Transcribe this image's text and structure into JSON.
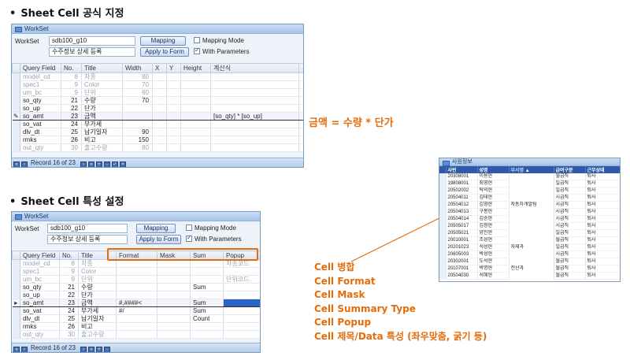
{
  "headings": {
    "formula": "Sheet Cell 공식 지정",
    "attributes": "Sheet Cell 특성 설정"
  },
  "panel1": {
    "title": "WorkSet",
    "workset_label": "WorkSet",
    "workset_value": "sdb100_g10",
    "name_value": "수주정보 상세 등록",
    "mapping_button": "Mapping",
    "apply_button": "Apply to Form",
    "mapping_mode_label": "Mapping Mode",
    "mapping_mode_checked": false,
    "with_params_label": "With Parameters",
    "with_params_checked": true,
    "columns": [
      "Query Field",
      "No.",
      "Title",
      "Width",
      "X",
      "Y",
      "Height",
      "계산식"
    ],
    "rows": [
      {
        "field": "model_cd",
        "no": "8",
        "title": "차종",
        "width": "80",
        "formula": "",
        "gray": true
      },
      {
        "field": "spec1",
        "no": "9",
        "title": "Color",
        "width": "70",
        "formula": "",
        "gray": true
      },
      {
        "field": "um_bc",
        "no": "9",
        "title": "단위",
        "width": "60",
        "formula": "",
        "gray": true
      },
      {
        "field": "so_qty",
        "no": "21",
        "title": "수량",
        "width": "70",
        "formula": "",
        "gray": false
      },
      {
        "field": "so_up",
        "no": "22",
        "title": "단가",
        "width": "",
        "formula": "",
        "gray": false
      },
      {
        "field": "so_amt",
        "no": "23",
        "title": "금액",
        "width": "",
        "formula": "[so_qty] * [so_up]",
        "gray": false,
        "selected": true
      },
      {
        "field": "so_vat",
        "no": "24",
        "title": "부가세",
        "width": "",
        "formula": "",
        "gray": false
      },
      {
        "field": "dlv_dt",
        "no": "25",
        "title": "납기일자",
        "width": "90",
        "formula": "",
        "gray": false
      },
      {
        "field": "rmks",
        "no": "26",
        "title": "비고",
        "width": "150",
        "formula": "",
        "gray": false
      },
      {
        "field": "out_qty",
        "no": "30",
        "title": "출고수량",
        "width": "80",
        "formula": "",
        "gray": true
      }
    ],
    "record_text": "Record 16 of 23"
  },
  "panel2": {
    "title": "WorkSet",
    "workset_label": "WorkSet",
    "workset_value": "sdb100_g10",
    "name_value": "수주정보 상세 등록",
    "mapping_button": "Mapping",
    "apply_button": "Apply to Form",
    "mapping_mode_label": "Mapping Mode",
    "with_params_label": "With Parameters",
    "columns": [
      "Query Field",
      "No.",
      "Title",
      "Format",
      "Mask",
      "Sum",
      "Popup"
    ],
    "rows": [
      {
        "field": "model_cd",
        "no": "8",
        "title": "차종",
        "format": "",
        "mask": "",
        "sum": "",
        "popup": "차종코드",
        "gray": true
      },
      {
        "field": "spec1",
        "no": "9",
        "title": "Color",
        "format": "",
        "mask": "",
        "sum": "",
        "popup": "",
        "gray": true
      },
      {
        "field": "um_bc",
        "no": "9",
        "title": "단위",
        "format": "",
        "mask": "",
        "sum": "",
        "popup": "단위코드",
        "gray": true
      },
      {
        "field": "so_qty",
        "no": "21",
        "title": "수량",
        "format": "",
        "mask": "",
        "sum": "Sum",
        "popup": "",
        "gray": false
      },
      {
        "field": "so_up",
        "no": "22",
        "title": "단가",
        "format": "",
        "mask": "",
        "sum": "",
        "popup": "",
        "gray": false
      },
      {
        "field": "so_amt",
        "no": "23",
        "title": "금액",
        "format": "#,####<",
        "mask": "",
        "sum": "Sum",
        "popup": "",
        "gray": false,
        "selected": true
      },
      {
        "field": "so_vat",
        "no": "24",
        "title": "부가세",
        "format": "#/",
        "mask": "",
        "sum": "Sum",
        "popup": "",
        "gray": false
      },
      {
        "field": "dlv_dt",
        "no": "25",
        "title": "납기일자",
        "format": "",
        "mask": "",
        "sum": "Count",
        "popup": "",
        "gray": false
      },
      {
        "field": "rmks",
        "no": "26",
        "title": "비고",
        "format": "",
        "mask": "",
        "sum": "",
        "popup": "",
        "gray": false
      },
      {
        "field": "out_qty",
        "no": "30",
        "title": "출고수량",
        "format": "",
        "mask": "",
        "sum": "",
        "popup": "",
        "gray": true
      }
    ],
    "record_text": "Record 16 of 23"
  },
  "annotations": {
    "formula_note": "금액 = 수량 * 단가",
    "features": [
      "Cell 병합",
      "Cell Format",
      "Cell Mask",
      "Cell Summary Type",
      "Cell Popup",
      "Cell 제목/Data 특성 (좌우맞춤, 굵기 등)"
    ]
  },
  "employee_panel": {
    "title": "사원정보",
    "columns": [
      "사번",
      "성명",
      "부서명",
      "급여구분",
      "근무상태"
    ],
    "rows": [
      {
        "id": "20308001",
        "name": "이용현",
        "pay": "월급직",
        "status": "퇴사"
      },
      {
        "id": "19808001",
        "name": "최영현",
        "pay": "일급직",
        "status": "퇴사"
      },
      {
        "id": "20502002",
        "name": "탁의현",
        "pay": "일급직",
        "status": "퇴사"
      },
      {
        "id": "20504011",
        "name": "김태현",
        "pay": "시급직",
        "status": "퇴사"
      },
      {
        "id": "20504012",
        "name": "김영현",
        "pay": "시급직",
        "status": "퇴사"
      },
      {
        "id": "20504013",
        "name": "구봉현",
        "pay": "시급직",
        "status": "퇴사"
      },
      {
        "id": "20504014",
        "name": "김승현",
        "pay": "시급직",
        "status": "퇴사"
      },
      {
        "id": "20505017",
        "name": "김정현",
        "pay": "시급직",
        "status": "퇴사"
      },
      {
        "id": "20505021",
        "name": "양진현",
        "pay": "일급직",
        "status": "퇴사"
      },
      {
        "id": "20010001",
        "name": "조성현",
        "pay": "월급직",
        "status": "퇴사"
      },
      {
        "id": "20201023",
        "name": "석성현",
        "pay": "일급직",
        "status": "퇴사"
      },
      {
        "id": "20605003",
        "name": "박성현",
        "pay": "시급직",
        "status": "퇴사"
      },
      {
        "id": "20302001",
        "name": "도석현",
        "pay": "월급직",
        "status": "퇴사"
      },
      {
        "id": "20107001",
        "name": "박명현",
        "pay": "월급직",
        "status": "퇴사"
      },
      {
        "id": "20504030",
        "name": "석혜현",
        "pay": "월급직",
        "status": "퇴사"
      }
    ],
    "merged_depts": [
      "자동차개발팀",
      "자재과",
      "전산과"
    ]
  },
  "colors": {
    "accent": "#e46c0a",
    "grid_header": "#2e5aa8"
  }
}
